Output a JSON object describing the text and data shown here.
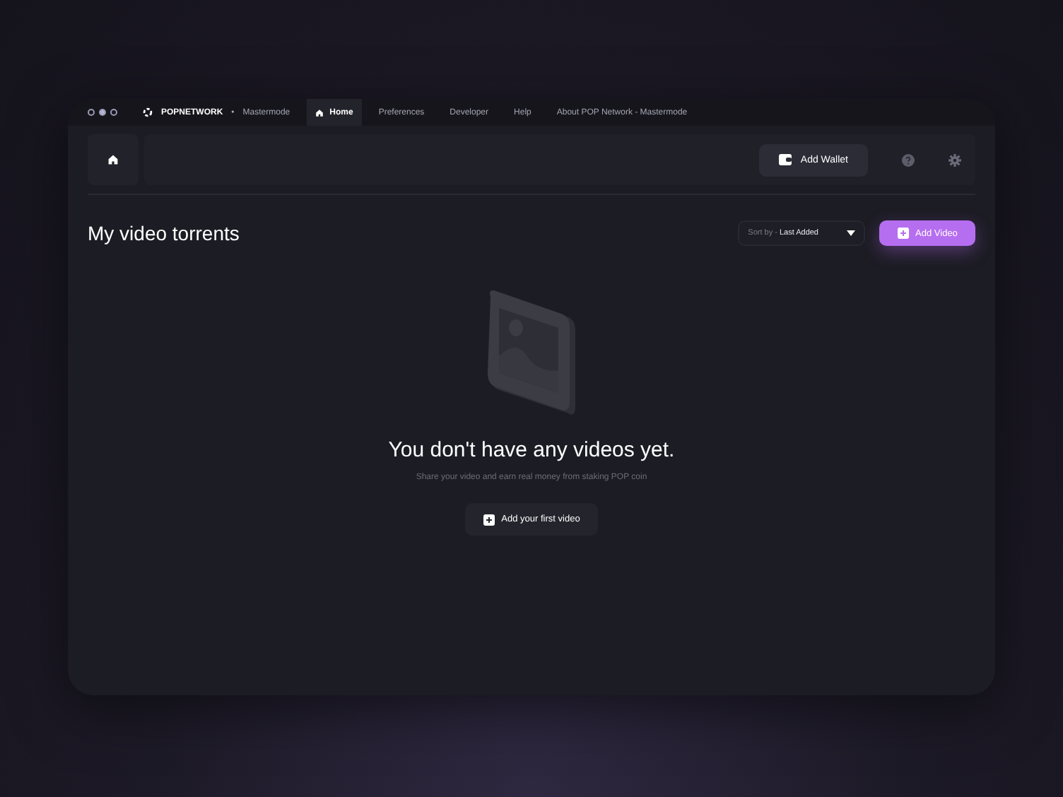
{
  "titlebar": {
    "brand": "POPNETWORK",
    "separator": "•",
    "mode": "Mastermode",
    "menu": [
      {
        "label": "Home",
        "selected": true
      },
      {
        "label": "Preferences",
        "selected": false
      },
      {
        "label": "Developer",
        "selected": false
      },
      {
        "label": "Help",
        "selected": false
      },
      {
        "label": "About POP Network - Mastermode",
        "selected": false
      }
    ]
  },
  "header": {
    "wallet_button": "Add Wallet"
  },
  "page": {
    "title": "My video torrents",
    "sort": {
      "label": "Sort by - ",
      "value": "Last Added"
    },
    "add_button": "Add Video"
  },
  "empty_state": {
    "heading": "You don't have any videos yet.",
    "text": "Share your video and earn real money from staking POP coin",
    "button": "Add your first video"
  }
}
